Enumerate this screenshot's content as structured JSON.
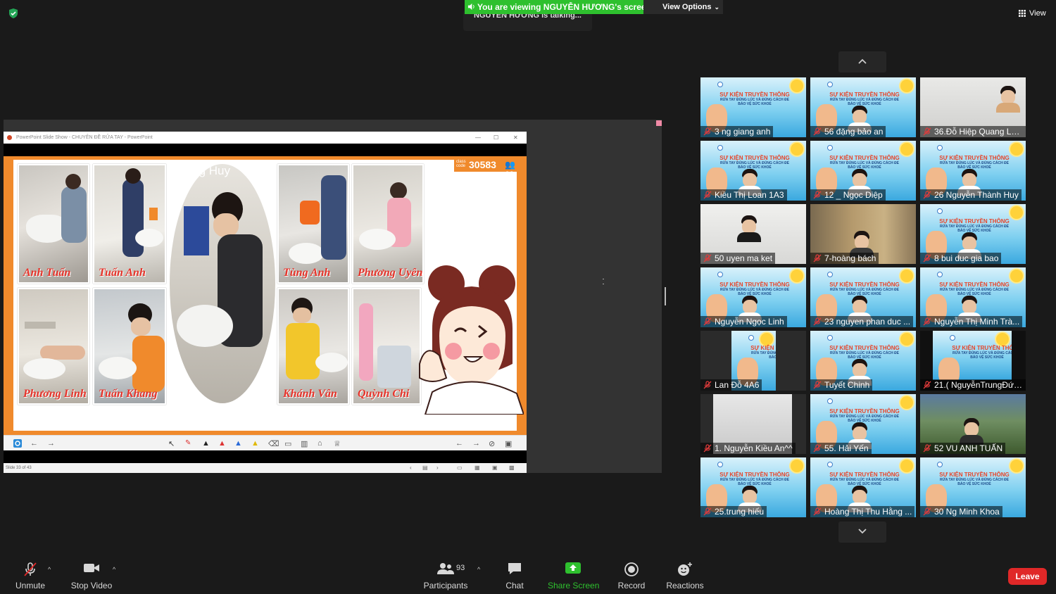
{
  "meeting": {
    "viewing_banner": "You are viewing NGUYỄN HƯƠNG's screen",
    "talking_text": "NGUYỄN HƯƠNG is talking...",
    "view_options_label": "View Options",
    "view_label": "View"
  },
  "shared_screen": {
    "window_title": "PowerPoint Slide Show - CHUYÊN ĐỀ RỬA TAY - PowerPoint",
    "class_code_label": "class code",
    "class_code": "30583",
    "participant_count": "69",
    "status_text": "Slide 33 of 43",
    "captions": [
      "Anh Tuấn",
      "Tuấn Anh",
      "Quang Huy",
      "Tùng Anh",
      "Phương Uyên",
      "Phương Linh",
      "Tuấn Khang",
      "Khánh Vân",
      "Quỳnh Chi"
    ]
  },
  "gallery": {
    "tiles": [
      {
        "name": "3 ng giang anh"
      },
      {
        "name": "56 đặng  bảo an"
      },
      {
        "name": "36.Đỗ Hiệp Quang Lo..."
      },
      {
        "name": "Kiều Thị Loan 1A3"
      },
      {
        "name": "12 _ Ngọc Diệp"
      },
      {
        "name": "26 Nguyễn Thành Huy"
      },
      {
        "name": "50 uyen ma ket"
      },
      {
        "name": "7-hoàng bách"
      },
      {
        "name": "8 bui duc gia bao"
      },
      {
        "name": "Nguyễn Ngọc Linh"
      },
      {
        "name": "23 nguyen phan duc ..."
      },
      {
        "name": "Nguyễn Thị Minh Trà..."
      },
      {
        "name": "Lan Đỗ 4A6"
      },
      {
        "name": "Tuyết Chinh"
      },
      {
        "name": "21.( NguyễnTrungĐức..."
      },
      {
        "name": "1. Nguyễn Kiều An^^"
      },
      {
        "name": "55. Hải Yến"
      },
      {
        "name": "52 VU ANH TUẤN"
      },
      {
        "name": "25.trung hiếu"
      },
      {
        "name": "Hoàng Thị Thu Hằng ..."
      },
      {
        "name": "30 Ng Minh Khoa"
      }
    ],
    "poster_title": "SỰ KIỆN TRUYỀN THÔNG",
    "poster_sub": "RỬA TAY ĐÚNG LÚC VÀ ĐÚNG CÁCH ĐỂ BẢO VỆ SỨC KHOẺ"
  },
  "toolbar": {
    "unmute_label": "Unmute",
    "stop_video_label": "Stop Video",
    "participants_label": "Participants",
    "participants_count": "93",
    "chat_label": "Chat",
    "share_screen_label": "Share Screen",
    "record_label": "Record",
    "reactions_label": "Reactions",
    "leave_label": "Leave"
  },
  "colors": {
    "banner_green": "#2ec02e",
    "share_green": "#2ec02e",
    "leave_red": "#e02828",
    "slide_orange": "#f08a2c"
  }
}
